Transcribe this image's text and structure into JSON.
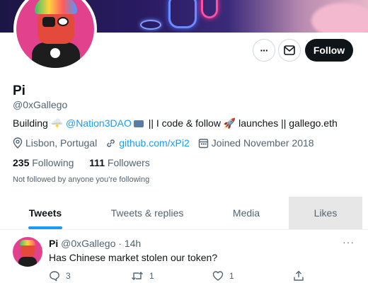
{
  "profile": {
    "name": "Pi",
    "handle": "@0xGallego",
    "bio": {
      "prefix": "Building ",
      "mention": "@Nation3DAO",
      "suffix": " || I code & follow 🚀 launches || gallego.eth"
    },
    "location": "Lisbon, Portugal",
    "website": "github.com/xPi2",
    "joined": "Joined November 2018",
    "following_count": "235",
    "following_label": "Following",
    "followers_count": "111",
    "followers_label": "Followers",
    "not_followed": "Not followed by anyone you’re following"
  },
  "actions": {
    "more": "···",
    "follow": "Follow"
  },
  "tabs": [
    {
      "label": "Tweets",
      "active": true
    },
    {
      "label": "Tweets & replies",
      "active": false
    },
    {
      "label": "Media",
      "active": false
    },
    {
      "label": "Likes",
      "active": false
    }
  ],
  "tweet": {
    "name": "Pi",
    "handle": "@0xGallego",
    "sep": "·",
    "time": "14h",
    "text": "Has Chinese market stolen our token?",
    "more": "···",
    "replies": "3",
    "retweets": "1",
    "likes": "1"
  },
  "colors": {
    "accent": "#1d9bf0",
    "text": "#0f1419",
    "muted": "#536471",
    "hover_tab": "#e7e7e8"
  }
}
